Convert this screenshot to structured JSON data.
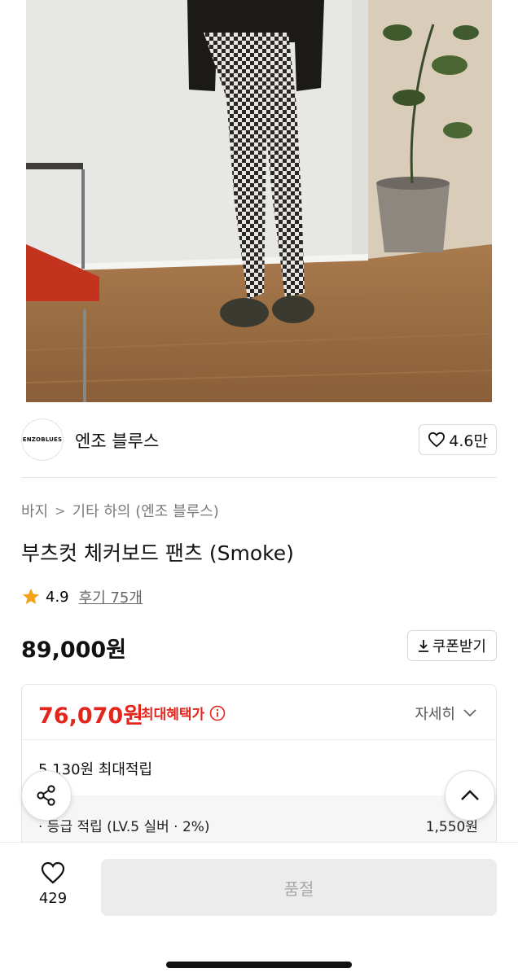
{
  "brand": {
    "logo_text": "ENZOBLUES",
    "name": "엔조 블루스",
    "like_count": "4.6만"
  },
  "breadcrumb": {
    "category": "바지",
    "subcategory": "기타 하의 (엔조 블루스)"
  },
  "product": {
    "title": "부츠컷 체커보드 팬츠 (Smoke)",
    "rating": "4.9",
    "reviews": "후기 75개",
    "price": "89,000원",
    "coupon_label": "쿠폰받기"
  },
  "benefit": {
    "max_price": "76,070원",
    "max_label": "최대혜택가",
    "detail_label": "자세히",
    "points_title": "5,130원 최대적립",
    "points_line": "· 등급 적립 (LV.5 실버 · 2%)",
    "points_value": "1,550원"
  },
  "bottom_bar": {
    "wish_count": "429",
    "buy_label": "품절"
  },
  "icons": {
    "heart": "heart-icon",
    "star": "star-icon",
    "download": "download-icon",
    "info": "info-icon",
    "chevron": "chevron-down-icon",
    "share": "share-icon",
    "up": "chevron-up-icon"
  },
  "colors": {
    "accent_red": "#e2261d",
    "star_gold": "#f2a31b",
    "disabled_bg": "#ececec"
  }
}
